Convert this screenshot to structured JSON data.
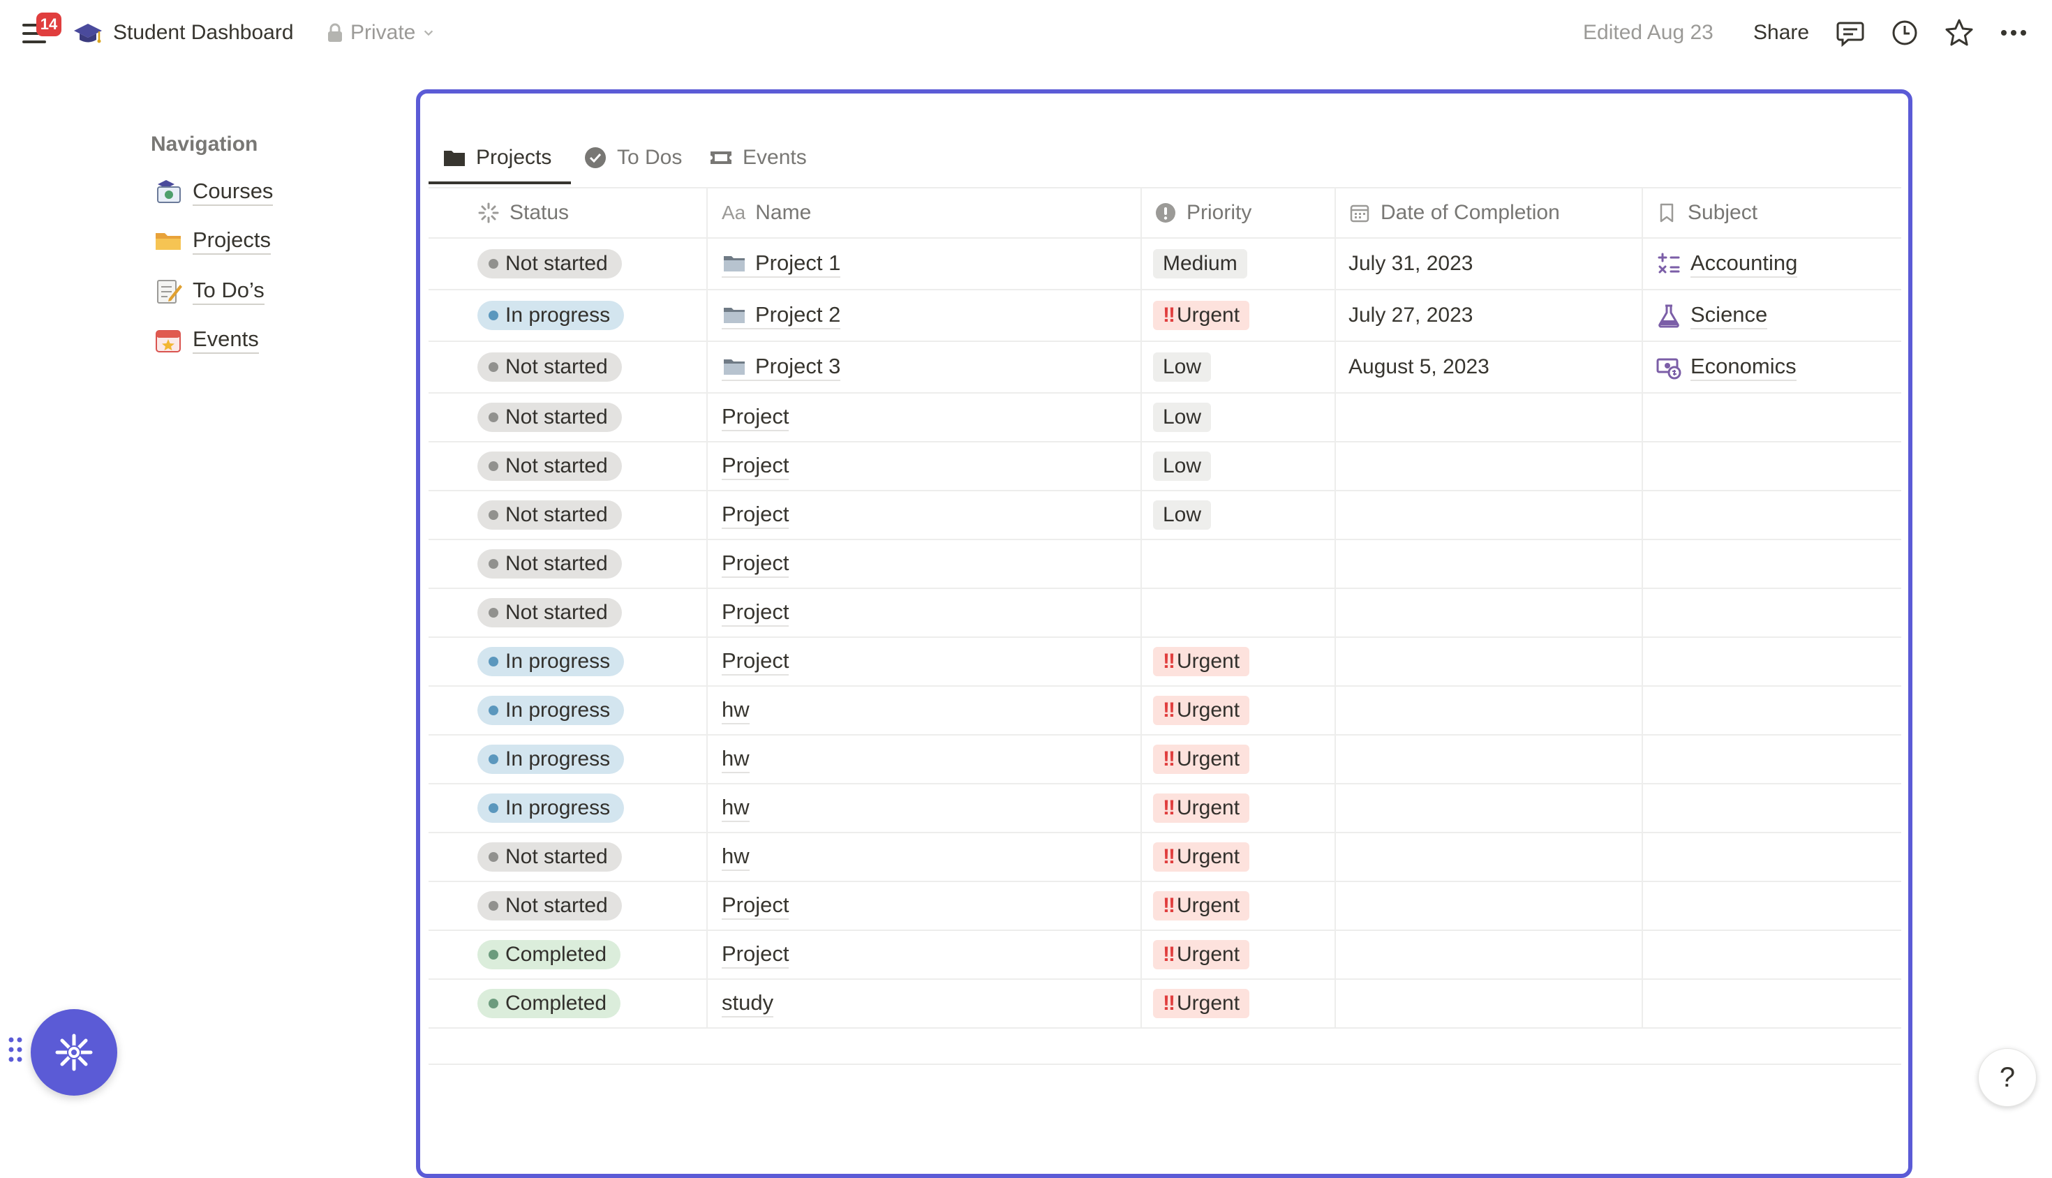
{
  "topbar": {
    "notification_count": "14",
    "title": "Student Dashboard",
    "privacy": "Private",
    "edited": "Edited Aug 23",
    "share": "Share",
    "icons": [
      "menu-icon",
      "graduation-cap-icon",
      "lock-icon",
      "chevron-down-icon",
      "comment-icon",
      "history-clock-icon",
      "star-icon",
      "more-dots-icon"
    ]
  },
  "nav": {
    "heading": "Navigation",
    "items": [
      {
        "label": "Courses",
        "icon": "courses-icon"
      },
      {
        "label": "Projects",
        "icon": "folder-icon"
      },
      {
        "label": "To Do’s",
        "icon": "memo-icon"
      },
      {
        "label": "Events",
        "icon": "calendar-icon"
      }
    ]
  },
  "tabs": [
    {
      "label": "Projects",
      "icon": "folder-icon",
      "active": true
    },
    {
      "label": "To Dos",
      "icon": "check-circle-icon",
      "active": false
    },
    {
      "label": "Events",
      "icon": "ticket-icon",
      "active": false
    }
  ],
  "columns": {
    "status": "Status",
    "name": "Name",
    "priority": "Priority",
    "date": "Date of Completion",
    "subject": "Subject"
  },
  "rows": [
    {
      "status": "Not started",
      "name": "Project 1",
      "page_icon": true,
      "priority": "Medium",
      "urgent": false,
      "date": "July 31, 2023",
      "subject": "Accounting",
      "subject_icon": "math-symbols-icon"
    },
    {
      "status": "In progress",
      "name": "Project 2",
      "page_icon": true,
      "priority": "Urgent",
      "urgent": true,
      "date": "July 27, 2023",
      "subject": "Science",
      "subject_icon": "flask-icon"
    },
    {
      "status": "Not started",
      "name": "Project 3",
      "page_icon": true,
      "priority": "Low",
      "urgent": false,
      "date": "August 5, 2023",
      "subject": "Economics",
      "subject_icon": "money-icon"
    },
    {
      "status": "Not started",
      "name": "Project",
      "page_icon": false,
      "priority": "Low",
      "urgent": false,
      "date": "",
      "subject": ""
    },
    {
      "status": "Not started",
      "name": "Project",
      "page_icon": false,
      "priority": "Low",
      "urgent": false,
      "date": "",
      "subject": ""
    },
    {
      "status": "Not started",
      "name": "Project",
      "page_icon": false,
      "priority": "Low",
      "urgent": false,
      "date": "",
      "subject": ""
    },
    {
      "status": "Not started",
      "name": "Project",
      "page_icon": false,
      "priority": "",
      "urgent": false,
      "date": "",
      "subject": ""
    },
    {
      "status": "Not started",
      "name": "Project",
      "page_icon": false,
      "priority": "",
      "urgent": false,
      "date": "",
      "subject": ""
    },
    {
      "status": "In progress",
      "name": "Project",
      "page_icon": false,
      "priority": "Urgent",
      "urgent": true,
      "date": "",
      "subject": ""
    },
    {
      "status": "In progress",
      "name": "hw",
      "page_icon": false,
      "priority": "Urgent",
      "urgent": true,
      "date": "",
      "subject": ""
    },
    {
      "status": "In progress",
      "name": "hw",
      "page_icon": false,
      "priority": "Urgent",
      "urgent": true,
      "date": "",
      "subject": ""
    },
    {
      "status": "In progress",
      "name": "hw",
      "page_icon": false,
      "priority": "Urgent",
      "urgent": true,
      "date": "",
      "subject": ""
    },
    {
      "status": "Not started",
      "name": "hw",
      "page_icon": false,
      "priority": "Urgent",
      "urgent": true,
      "date": "",
      "subject": ""
    },
    {
      "status": "Not started",
      "name": "Project",
      "page_icon": false,
      "priority": "Urgent",
      "urgent": true,
      "date": "",
      "subject": ""
    },
    {
      "status": "Completed",
      "name": "Project",
      "page_icon": false,
      "priority": "Urgent",
      "urgent": true,
      "date": "",
      "subject": ""
    },
    {
      "status": "Completed",
      "name": "study",
      "page_icon": false,
      "priority": "Urgent",
      "urgent": true,
      "date": "",
      "subject": ""
    }
  ],
  "status_colors": {
    "Not started": {
      "bg": "#e3e2e0",
      "dot": "#91918e"
    },
    "In progress": {
      "bg": "#d3e5ef",
      "dot": "#5b97bd"
    },
    "Completed": {
      "bg": "#dbeddb",
      "dot": "#6c9b7d"
    }
  },
  "priority_colors": {
    "Urgent": "#fde2dd",
    "Medium": "#eeeeec",
    "Low": "#eeeeec"
  },
  "accent": "#5b5bd6",
  "help_label": "?"
}
